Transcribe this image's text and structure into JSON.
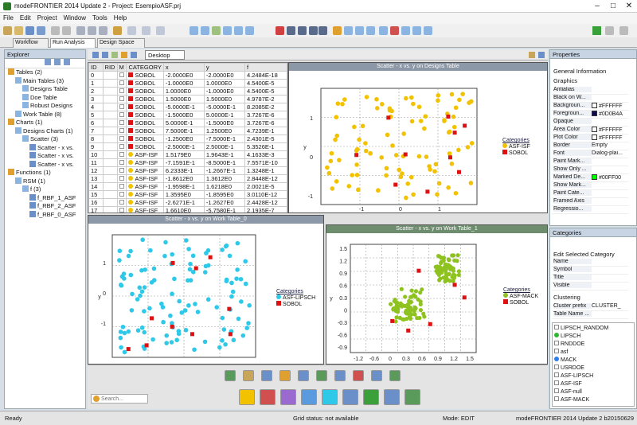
{
  "window": {
    "title": "modeFRONTIER 2014 Update 2 - Project: EsempioASF.prj",
    "controls": [
      "–",
      "□",
      "✕"
    ]
  },
  "menu": [
    "File",
    "Edit",
    "Project",
    "Window",
    "Tools",
    "Help"
  ],
  "tabs": [
    {
      "label": "Workflow"
    },
    {
      "label": "Run Analysis"
    },
    {
      "label": "Design Space"
    }
  ],
  "explorer": {
    "title": "Explorer",
    "tree": [
      {
        "label": "Tables (2)",
        "level": 0
      },
      {
        "label": "Main Tables (3)",
        "level": 1
      },
      {
        "label": "Designs Table",
        "level": 2
      },
      {
        "label": "Doe Table",
        "level": 2
      },
      {
        "label": "Robust Designs",
        "level": 2
      },
      {
        "label": "Work Table (8)",
        "level": 1
      },
      {
        "label": "Charts (1)",
        "level": 0
      },
      {
        "label": "Designs Charts (1)",
        "level": 1
      },
      {
        "label": "Scatter (3)",
        "level": 2
      },
      {
        "label": "Scatter - x vs.",
        "level": 3
      },
      {
        "label": "Scatter - x vs.",
        "level": 3
      },
      {
        "label": "Scatter - x vs.",
        "level": 3
      },
      {
        "label": "Functions (1)",
        "level": 0
      },
      {
        "label": "RSM (1)",
        "level": 1
      },
      {
        "label": "f (3)",
        "level": 2
      },
      {
        "label": "f_RBF_1_ASF",
        "level": 3
      },
      {
        "label": "f_RBF_2_ASF",
        "level": 3
      },
      {
        "label": "f_RBF_0_ASF",
        "level": 3
      }
    ]
  },
  "desktop": {
    "label": "Desktop"
  },
  "table": {
    "headers": [
      "ID",
      "RID",
      "M",
      "CATEGORY",
      "x",
      "y",
      "f"
    ],
    "rows": [
      [
        "0",
        "",
        "",
        "SOBOL",
        "-2.0000E0",
        "-2.0000E0",
        "4.2484E-18"
      ],
      [
        "1",
        "",
        "",
        "SOBOL",
        "-1.0000E0",
        "1.0000E0",
        "4.5400E-5"
      ],
      [
        "2",
        "",
        "",
        "SOBOL",
        "1.0000E0",
        "-1.0000E0",
        "4.5400E-5"
      ],
      [
        "3",
        "",
        "",
        "SOBOL",
        "1.5000E0",
        "1.5000E0",
        "4.9787E-2"
      ],
      [
        "4",
        "",
        "",
        "SOBOL",
        "-5.0000E-1",
        "-5.0000E-1",
        "8.2085E-2"
      ],
      [
        "5",
        "",
        "",
        "SOBOL",
        "-1.5000E0",
        "5.0000E-1",
        "3.7267E-6"
      ],
      [
        "6",
        "",
        "",
        "SOBOL",
        "5.0000E-1",
        "-1.5000E0",
        "3.7267E-6"
      ],
      [
        "7",
        "",
        "",
        "SOBOL",
        "7.5000E-1",
        "1.2500E0",
        "4.7239E-1"
      ],
      [
        "8",
        "",
        "",
        "SOBOL",
        "-1.2500E0",
        "-7.5000E-1",
        "2.4301E-5"
      ],
      [
        "9",
        "",
        "",
        "SOBOL",
        "-2.5000E-1",
        "2.5000E-1",
        "5.3526E-1"
      ],
      [
        "10",
        "",
        "",
        "ASF-ISF",
        "1.5179E0",
        "1.9643E-1",
        "4.1633E-3"
      ],
      [
        "11",
        "",
        "",
        "ASF-ISF",
        "-7.1591E-1",
        "-8.5000E-1",
        "7.5571E-10"
      ],
      [
        "12",
        "",
        "",
        "ASF-ISF",
        "6.2333E-1",
        "-1.2667E-1",
        "1.3248E-1"
      ],
      [
        "13",
        "",
        "",
        "ASF-ISF",
        "-1.8612E0",
        "1.3612E0",
        "2.8448E-12"
      ],
      [
        "14",
        "",
        "",
        "ASF-ISF",
        "-1.9598E-1",
        "1.6218E0",
        "2.0021E-5"
      ],
      [
        "15",
        "",
        "",
        "ASF-ISF",
        "1.3595E0",
        "-1.8595E0",
        "3.0110E-12"
      ],
      [
        "16",
        "",
        "",
        "ASF-ISF",
        "-2.6271E-1",
        "-1.2627E0",
        "2.4428E-12"
      ],
      [
        "17",
        "",
        "",
        "ASF-ISF",
        "1.6610E0",
        "-5.7580E-1",
        "2.1935E-7"
      ]
    ]
  },
  "charts": {
    "designs": {
      "title": "Scatter - x vs. y on Designs Table",
      "xlabel": "x",
      "ylabel": "y",
      "xticks": [
        "-1",
        "0",
        "1"
      ],
      "yticks": [
        "1",
        "0",
        "-1"
      ],
      "legend_title": "Categories",
      "legend": [
        "ASF-ISF",
        "SOBOL"
      ]
    },
    "work0": {
      "title": "Scatter - x vs. y on Work Table_0",
      "xlabel": "x",
      "ylabel": "y",
      "xticks": [],
      "yticks": [
        "1",
        "0",
        "-1"
      ],
      "legend_title": "Categories",
      "legend": [
        "ASF-LIPSCH",
        "SOBOL"
      ]
    },
    "work1": {
      "title": "Scatter - x vs. y on Work Table_1",
      "xlabel": "x",
      "ylabel": "y",
      "xticks": [
        "-1.2",
        "-0.6",
        "0",
        "0.3",
        "0.6",
        "0.9",
        "1.2",
        "1.5"
      ],
      "yticks": [
        "1.5",
        "1.2",
        "0.9",
        "0.6",
        "0.3",
        "0",
        "-0.3",
        "-0.6",
        "-0.9"
      ],
      "legend_title": "Categories",
      "legend": [
        "ASF-MACK",
        "SOBOL"
      ]
    }
  },
  "colors": {
    "sobol": "#dd1111",
    "asf_isf": "#f2c200",
    "asf_lipsch": "#2ec8e8",
    "asf_mack": "#8ec21f",
    "accent": "#00ff00"
  },
  "properties": {
    "title": "Properties",
    "sections": [
      "General Information",
      "Graphics",
      "Clustering"
    ],
    "rows": [
      {
        "k": "Antialias",
        "v": ""
      },
      {
        "k": "Black on W...",
        "v": ""
      },
      {
        "k": "Backgroun...",
        "v": "#FFFFFF"
      },
      {
        "k": "Foregroun...",
        "v": "#0D0B4A"
      },
      {
        "k": "Opaque",
        "v": ""
      },
      {
        "k": "Area Color",
        "v": "#FFFFFF"
      },
      {
        "k": "Plot Color",
        "v": "#FFFFFF"
      },
      {
        "k": "Border",
        "v": "Empty"
      },
      {
        "k": "Font",
        "v": "Dialog-plai..."
      },
      {
        "k": "Paint Mark...",
        "v": ""
      },
      {
        "k": "Show Only ...",
        "v": ""
      },
      {
        "k": "Marked De...",
        "v": "#00FF00"
      },
      {
        "k": "Show Mark...",
        "v": ""
      },
      {
        "k": "Paint Cate...",
        "v": ""
      },
      {
        "k": "Framed Axis",
        "v": ""
      },
      {
        "k": "Regressio...",
        "v": ""
      }
    ]
  },
  "categories_panel": {
    "title": "Categories",
    "edit_label": "Edit Selected Category",
    "fields": [
      "Name",
      "Symbol",
      "Title",
      "Visible"
    ],
    "clustering_fields": [
      {
        "k": "Cluster prefix",
        "v": "CLUSTER_"
      },
      {
        "k": "Table Name ...",
        "v": ""
      }
    ],
    "list": [
      {
        "label": "LIPSCH_RANDOM",
        "icon": "none"
      },
      {
        "label": "LIPSCH",
        "icon": "green"
      },
      {
        "label": "RNDDOE",
        "icon": "none"
      },
      {
        "label": "asf",
        "icon": "none"
      },
      {
        "label": "MACK",
        "icon": "cyan"
      },
      {
        "label": "USRDOE",
        "icon": "none"
      },
      {
        "label": "ASF-LIPSCH",
        "icon": "none"
      },
      {
        "label": "ASF-ISF",
        "icon": "none"
      },
      {
        "label": "ASF-null",
        "icon": "none"
      },
      {
        "label": "ASF-MACK",
        "icon": "none"
      }
    ]
  },
  "search": {
    "placeholder": "Search..."
  },
  "status": {
    "left": "Ready",
    "grid": "Grid status: not available",
    "mode": "Mode: EDIT",
    "version": "modeFRONTIER 2014 Update 2 b20150629"
  }
}
